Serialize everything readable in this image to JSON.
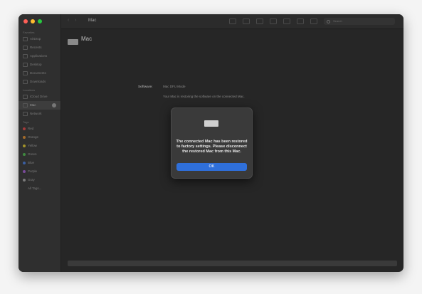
{
  "toolbar": {
    "title": "Mac",
    "search_placeholder": "Search"
  },
  "sidebar": {
    "sections": [
      {
        "heading": "Favorites",
        "items": [
          "AirDrop",
          "Recents",
          "Applications",
          "Desktop",
          "Documents",
          "Downloads"
        ]
      },
      {
        "heading": "Locations",
        "items": [
          "iCloud Drive",
          "Mac",
          "Network"
        ]
      },
      {
        "heading": "Tags",
        "items": [
          "Red",
          "Orange",
          "Yellow",
          "Green",
          "Blue",
          "Purple",
          "Gray",
          "All Tags..."
        ]
      }
    ],
    "tag_colors": [
      "#a33a3a",
      "#a36a2a",
      "#a3932a",
      "#3f8a3f",
      "#3a5fa3",
      "#7a4a9a",
      "#7a7a7a"
    ]
  },
  "device": {
    "name": "Mac",
    "software_label": "Software:",
    "software_value": "Mac DFU Mode",
    "status": "Your Mac is restoring the software on the connected Mac."
  },
  "dialog": {
    "message": "The connected Mac has been restored to factory settings. Please disconnect the restored Mac from this Mac.",
    "ok_label": "OK",
    "ok_color": "#2f6fd9"
  }
}
